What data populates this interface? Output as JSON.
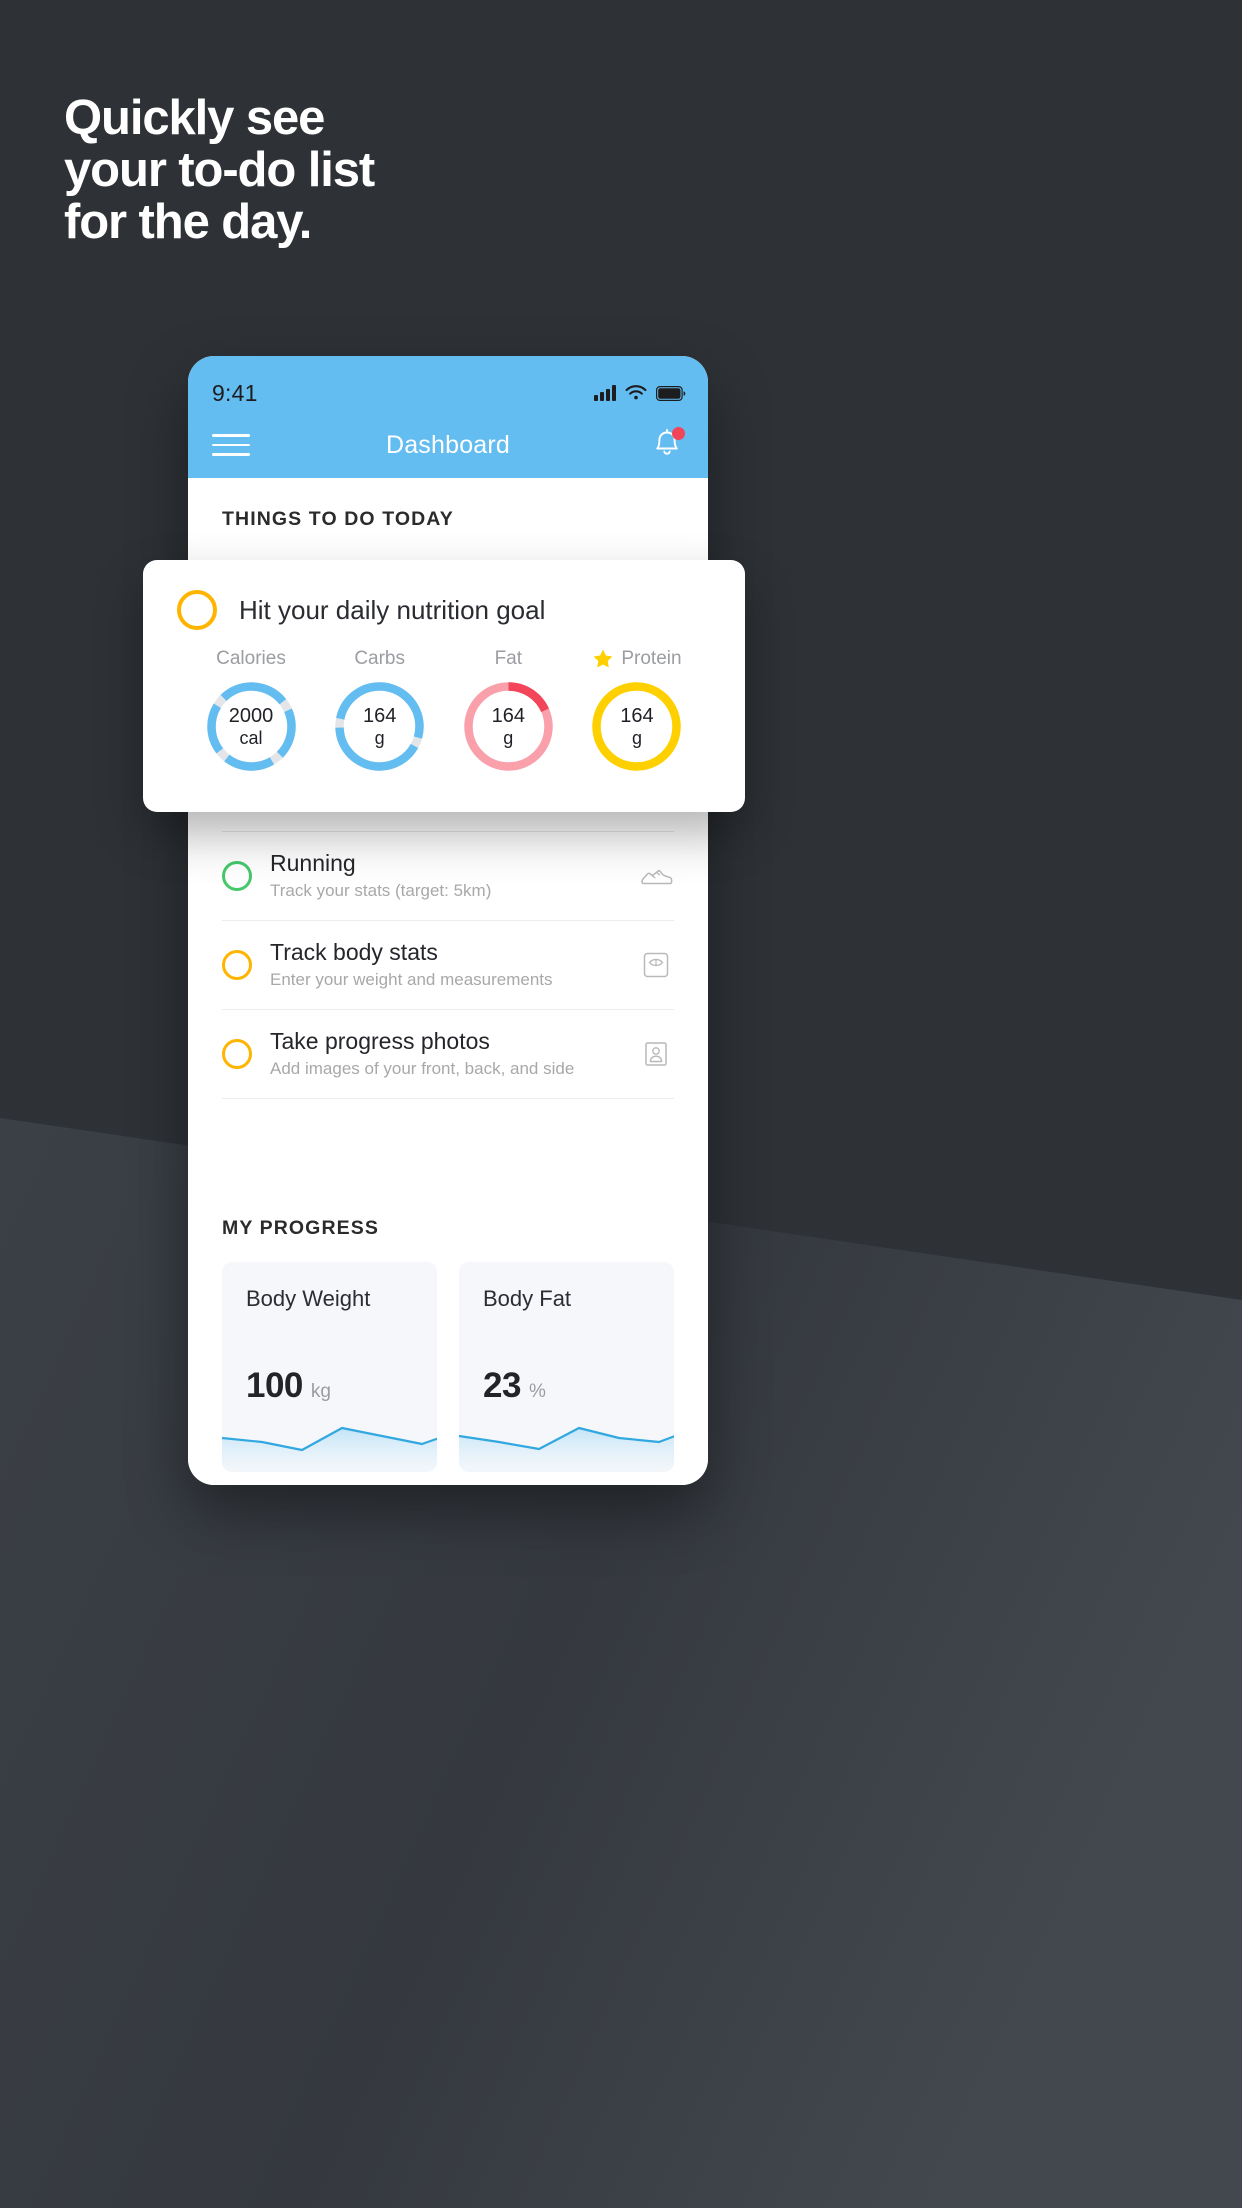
{
  "background": {
    "base_color": "#2e3237",
    "wedge_color": "#3c4147"
  },
  "headline": {
    "lines": [
      "Quickly see",
      "your to-do list",
      "for the day."
    ],
    "color": "#ffffff"
  },
  "phone": {
    "statusbar": {
      "clock": "9:41",
      "signal_icon": "signal-bars-icon",
      "wifi_icon": "wifi-icon",
      "battery_icon": "battery-icon",
      "bar_color": "#64bdf0"
    },
    "navbar": {
      "menu_icon": "hamburger-menu-icon",
      "title": "Dashboard",
      "bell_icon": "bell-icon",
      "badge_color": "#f2455a"
    },
    "sections": {
      "todo_title": "THINGS TO DO TODAY",
      "progress_title": "MY PROGRESS"
    },
    "tasks": [
      {
        "title": "Running",
        "subtitle": "Track your stats (target: 5km)",
        "check_color": "#45c96a",
        "icon": "sneaker-icon"
      },
      {
        "title": "Track body stats",
        "subtitle": "Enter your weight and measurements",
        "check_color": "#ffb400",
        "icon": "scale-icon"
      },
      {
        "title": "Take progress photos",
        "subtitle": "Add images of your front, back, and side",
        "check_color": "#ffb400",
        "icon": "photo-person-icon"
      }
    ],
    "progress_cards": [
      {
        "label": "Body Weight",
        "value": "100",
        "unit": "kg"
      },
      {
        "label": "Body Fat",
        "value": "23",
        "unit": "%"
      }
    ]
  },
  "nutrition_card": {
    "check_color": "#ffb400",
    "title": "Hit your daily nutrition goal",
    "star_icon": "star-icon",
    "macros": [
      {
        "name": "Calories",
        "value": "2000",
        "unit": "cal",
        "color": "#64bdf0",
        "track": "#e3e5e8",
        "starred": false
      },
      {
        "name": "Carbs",
        "value": "164",
        "unit": "g",
        "color": "#64bdf0",
        "track": "#e3e5e8",
        "starred": false
      },
      {
        "name": "Fat",
        "value": "164",
        "unit": "g",
        "color": "#f9a0ab",
        "accent": "#f2455a",
        "track": "#f9a0ab",
        "starred": false
      },
      {
        "name": "Protein",
        "value": "164",
        "unit": "g",
        "color": "#ffd000",
        "track": "#ffd000",
        "starred": true
      }
    ]
  },
  "chart_data": [
    {
      "type": "area",
      "title": "Body Weight",
      "ylabel": "kg",
      "x": [
        0,
        1,
        2,
        3,
        4,
        5,
        6
      ],
      "values": [
        34,
        30,
        22,
        44,
        36,
        28,
        42
      ],
      "ylim": [
        0,
        62
      ],
      "line_color": "#31a8e0",
      "fill_color": "#bfe3f7",
      "grid": false,
      "legend": "none"
    },
    {
      "type": "area",
      "title": "Body Fat",
      "ylabel": "%",
      "x": [
        0,
        1,
        2,
        3,
        4,
        5,
        6
      ],
      "values": [
        36,
        30,
        23,
        44,
        34,
        30,
        45
      ],
      "ylim": [
        0,
        62
      ],
      "line_color": "#31a8e0",
      "fill_color": "#bfe3f7",
      "grid": false,
      "legend": "none"
    }
  ]
}
